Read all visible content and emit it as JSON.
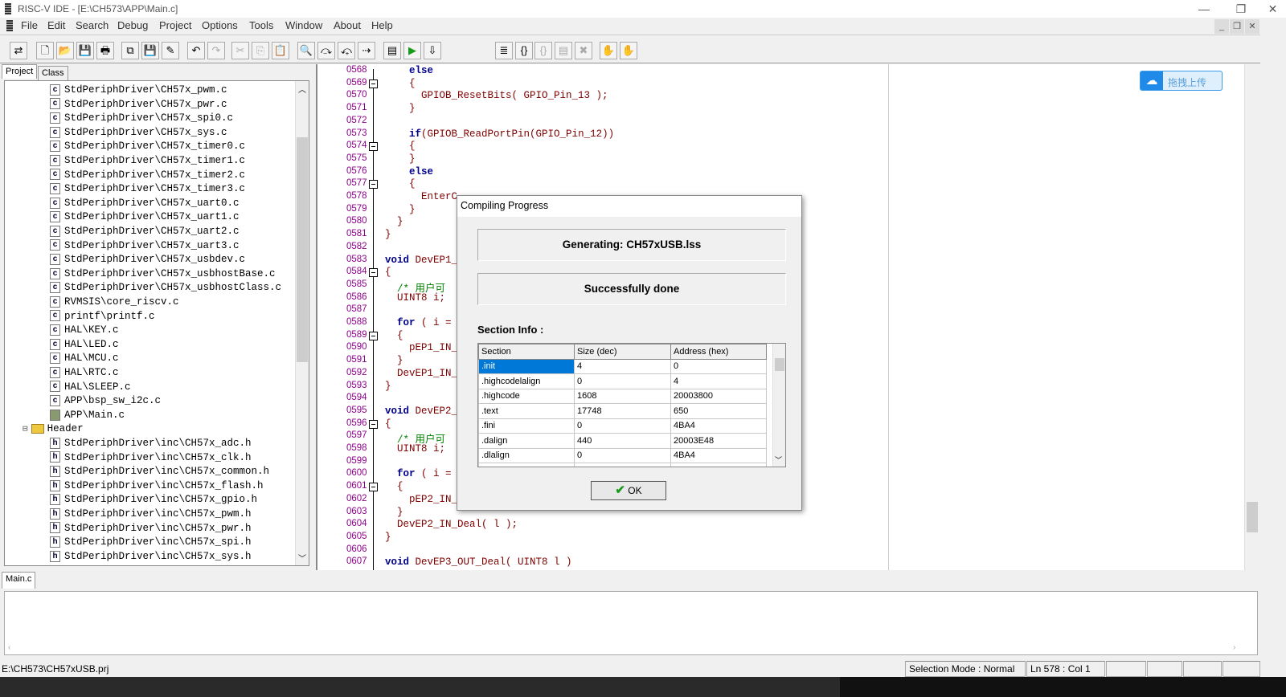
{
  "window": {
    "title": "RISC-V IDE - [E:\\CH573\\APP\\Main.c]",
    "minimize": "—",
    "restore": "❐",
    "close": "✕"
  },
  "menu": [
    "File",
    "Edit",
    "Search",
    "Debug",
    "Project",
    "Options",
    "Tools",
    "Window",
    "About",
    "Help"
  ],
  "toolbar": [
    {
      "name": "project-settings",
      "g": "⇄"
    },
    {
      "name": "new-file",
      "g": "🗋"
    },
    {
      "name": "open-folder",
      "g": "📂"
    },
    {
      "name": "save",
      "g": "💾"
    },
    {
      "name": "print",
      "g": "🖶"
    },
    {
      "name": "copy-files",
      "g": "⧉"
    },
    {
      "name": "save-all",
      "g": "💾"
    },
    {
      "name": "build-settings",
      "g": "✎"
    },
    {
      "name": "undo",
      "g": "↶"
    },
    {
      "name": "redo",
      "g": "↷",
      "d": true
    },
    {
      "name": "cut",
      "g": "✂",
      "d": true
    },
    {
      "name": "copy",
      "g": "⎘",
      "d": true
    },
    {
      "name": "paste",
      "g": "📋"
    },
    {
      "name": "find",
      "g": "🔍"
    },
    {
      "name": "find-next",
      "g": "⤼"
    },
    {
      "name": "find-prev",
      "g": "⤽"
    },
    {
      "name": "replace",
      "g": "⇢"
    },
    {
      "name": "compile",
      "g": "▤"
    },
    {
      "name": "run",
      "g": "▶"
    },
    {
      "name": "download",
      "g": "⇩"
    }
  ],
  "toolbar2": [
    {
      "name": "step-into",
      "g": "≣"
    },
    {
      "name": "step-over",
      "g": "{}"
    },
    {
      "name": "step-out",
      "g": "{}",
      "d": true
    },
    {
      "name": "run-to-cursor",
      "g": "▤",
      "d": true
    },
    {
      "name": "stop-debug",
      "g": "✖",
      "d": true
    },
    {
      "name": "breakpoint",
      "g": "✋"
    },
    {
      "name": "clear-breakpoints",
      "g": "✋",
      "d": true
    }
  ],
  "left": {
    "tabs": [
      "Project",
      "Class"
    ],
    "tree": [
      {
        "t": "StdPeriphDriver\\CH57x_pwm.c",
        "k": "c"
      },
      {
        "t": "StdPeriphDriver\\CH57x_pwr.c",
        "k": "c"
      },
      {
        "t": "StdPeriphDriver\\CH57x_spi0.c",
        "k": "c"
      },
      {
        "t": "StdPeriphDriver\\CH57x_sys.c",
        "k": "c"
      },
      {
        "t": "StdPeriphDriver\\CH57x_timer0.c",
        "k": "c"
      },
      {
        "t": "StdPeriphDriver\\CH57x_timer1.c",
        "k": "c"
      },
      {
        "t": "StdPeriphDriver\\CH57x_timer2.c",
        "k": "c"
      },
      {
        "t": "StdPeriphDriver\\CH57x_timer3.c",
        "k": "c"
      },
      {
        "t": "StdPeriphDriver\\CH57x_uart0.c",
        "k": "c"
      },
      {
        "t": "StdPeriphDriver\\CH57x_uart1.c",
        "k": "c"
      },
      {
        "t": "StdPeriphDriver\\CH57x_uart2.c",
        "k": "c"
      },
      {
        "t": "StdPeriphDriver\\CH57x_uart3.c",
        "k": "c"
      },
      {
        "t": "StdPeriphDriver\\CH57x_usbdev.c",
        "k": "c"
      },
      {
        "t": "StdPeriphDriver\\CH57x_usbhostBase.c",
        "k": "c"
      },
      {
        "t": "StdPeriphDriver\\CH57x_usbhostClass.c",
        "k": "c"
      },
      {
        "t": "RVMSIS\\core_riscv.c",
        "k": "c"
      },
      {
        "t": "printf\\printf.c",
        "k": "c"
      },
      {
        "t": "HAL\\KEY.c",
        "k": "c"
      },
      {
        "t": "HAL\\LED.c",
        "k": "c"
      },
      {
        "t": "HAL\\MCU.c",
        "k": "c"
      },
      {
        "t": "HAL\\RTC.c",
        "k": "c"
      },
      {
        "t": "HAL\\SLEEP.c",
        "k": "c"
      },
      {
        "t": "APP\\bsp_sw_i2c.c",
        "k": "c"
      },
      {
        "t": "APP\\Main.c",
        "k": "main"
      },
      {
        "t": "Header",
        "k": "folder"
      },
      {
        "t": "StdPeriphDriver\\inc\\CH57x_adc.h",
        "k": "h"
      },
      {
        "t": "StdPeriphDriver\\inc\\CH57x_clk.h",
        "k": "h"
      },
      {
        "t": "StdPeriphDriver\\inc\\CH57x_common.h",
        "k": "h"
      },
      {
        "t": "StdPeriphDriver\\inc\\CH57x_flash.h",
        "k": "h"
      },
      {
        "t": "StdPeriphDriver\\inc\\CH57x_gpio.h",
        "k": "h"
      },
      {
        "t": "StdPeriphDriver\\inc\\CH57x_pwm.h",
        "k": "h"
      },
      {
        "t": "StdPeriphDriver\\inc\\CH57x_pwr.h",
        "k": "h"
      },
      {
        "t": "StdPeriphDriver\\inc\\CH57x_spi.h",
        "k": "h"
      },
      {
        "t": "StdPeriphDriver\\inc\\CH57x_sys.h",
        "k": "h"
      }
    ]
  },
  "editor": {
    "lines": [
      {
        "n": "0568",
        "c": [
          [
            "    ",
            ""
          ],
          [
            "else",
            "kw"
          ]
        ]
      },
      {
        "n": "0569",
        "f": 1,
        "c": [
          [
            "    {",
            "id"
          ]
        ]
      },
      {
        "n": "0570",
        "c": [
          [
            "      GPIOB_ResetBits( GPIO_Pin_13 );",
            "id"
          ]
        ]
      },
      {
        "n": "0571",
        "c": [
          [
            "    }",
            "id"
          ]
        ]
      },
      {
        "n": "0572",
        "c": []
      },
      {
        "n": "0573",
        "c": [
          [
            "    ",
            ""
          ],
          [
            "if",
            "kw"
          ],
          [
            "(GPIOB_ReadPortPin(GPIO_Pin_12))",
            "id"
          ]
        ]
      },
      {
        "n": "0574",
        "f": 1,
        "c": [
          [
            "    {",
            "id"
          ]
        ]
      },
      {
        "n": "0575",
        "c": [
          [
            "    }",
            "id"
          ]
        ]
      },
      {
        "n": "0576",
        "c": [
          [
            "    ",
            ""
          ],
          [
            "else",
            "kw"
          ]
        ]
      },
      {
        "n": "0577",
        "f": 1,
        "c": [
          [
            "    {",
            "id"
          ]
        ]
      },
      {
        "n": "0578",
        "c": [
          [
            "      EnterC",
            "id"
          ]
        ]
      },
      {
        "n": "0579",
        "c": [
          [
            "    }",
            "id"
          ]
        ]
      },
      {
        "n": "0580",
        "c": [
          [
            "  }",
            "id"
          ]
        ]
      },
      {
        "n": "0581",
        "c": [
          [
            "}",
            "id"
          ]
        ]
      },
      {
        "n": "0582",
        "c": []
      },
      {
        "n": "0583",
        "c": [
          [
            "void",
            "kw"
          ],
          [
            " DevEP1_",
            "id"
          ]
        ]
      },
      {
        "n": "0584",
        "f": 1,
        "c": [
          [
            "{",
            "id"
          ]
        ]
      },
      {
        "n": "0585",
        "c": [
          [
            "  /* 用户可",
            "cm"
          ]
        ]
      },
      {
        "n": "0586",
        "c": [
          [
            "  UINT8 i;",
            "id"
          ]
        ]
      },
      {
        "n": "0587",
        "c": []
      },
      {
        "n": "0588",
        "c": [
          [
            "  ",
            ""
          ],
          [
            "for",
            "kw"
          ],
          [
            " ( i =",
            "id"
          ]
        ]
      },
      {
        "n": "0589",
        "f": 1,
        "c": [
          [
            "  {",
            "id"
          ]
        ]
      },
      {
        "n": "0590",
        "c": [
          [
            "    pEP1_IN_",
            "id"
          ]
        ]
      },
      {
        "n": "0591",
        "c": [
          [
            "  }",
            "id"
          ]
        ]
      },
      {
        "n": "0592",
        "c": [
          [
            "  DevEP1_IN_",
            "id"
          ]
        ]
      },
      {
        "n": "0593",
        "c": [
          [
            "}",
            "id"
          ]
        ]
      },
      {
        "n": "0594",
        "c": []
      },
      {
        "n": "0595",
        "c": [
          [
            "void",
            "kw"
          ],
          [
            " DevEP2_",
            "id"
          ]
        ]
      },
      {
        "n": "0596",
        "f": 1,
        "c": [
          [
            "{",
            "id"
          ]
        ]
      },
      {
        "n": "0597",
        "c": [
          [
            "  /* 用户可",
            "cm"
          ]
        ]
      },
      {
        "n": "0598",
        "c": [
          [
            "  UINT8 i;",
            "id"
          ]
        ]
      },
      {
        "n": "0599",
        "c": []
      },
      {
        "n": "0600",
        "c": [
          [
            "  ",
            ""
          ],
          [
            "for",
            "kw"
          ],
          [
            " ( i =",
            "id"
          ]
        ]
      },
      {
        "n": "0601",
        "f": 1,
        "c": [
          [
            "  {",
            "id"
          ]
        ]
      },
      {
        "n": "0602",
        "c": [
          [
            "    pEP2_IN_",
            "id"
          ]
        ]
      },
      {
        "n": "0603",
        "c": [
          [
            "  }",
            "id"
          ]
        ]
      },
      {
        "n": "0604",
        "c": [
          [
            "  DevEP2_IN_Deal( l );",
            "id"
          ]
        ]
      },
      {
        "n": "0605",
        "c": [
          [
            "}",
            "id"
          ]
        ]
      },
      {
        "n": "0606",
        "c": []
      },
      {
        "n": "0607",
        "c": [
          [
            "void",
            "kw"
          ],
          [
            " DevEP3_OUT_Deal( UINT8 l )",
            "id"
          ]
        ]
      }
    ]
  },
  "upload": {
    "label": "拖拽上传"
  },
  "dialog": {
    "title": "Compiling Progress",
    "generating": "Generating: CH57xUSB.lss",
    "done": "Successfully done",
    "section_label": "Section Info :",
    "columns": [
      "Section",
      "Size (dec)",
      "Address (hex)"
    ],
    "rows": [
      [
        ".init",
        "4",
        "0"
      ],
      [
        ".highcodelalign",
        "0",
        "4"
      ],
      [
        ".highcode",
        "1608",
        "20003800"
      ],
      [
        ".text",
        "17748",
        "650"
      ],
      [
        ".fini",
        "0",
        "4BA4"
      ],
      [
        ".dalign",
        "440",
        "20003E48"
      ],
      [
        ".dlalign",
        "0",
        "4BA4"
      ]
    ],
    "ok": "OK"
  },
  "bottom": {
    "tab": "Main.c"
  },
  "status": {
    "path": "E:\\CH573\\CH57xUSB.prj",
    "mode": "Selection Mode : Normal",
    "pos": "Ln 578 : Col 1"
  }
}
